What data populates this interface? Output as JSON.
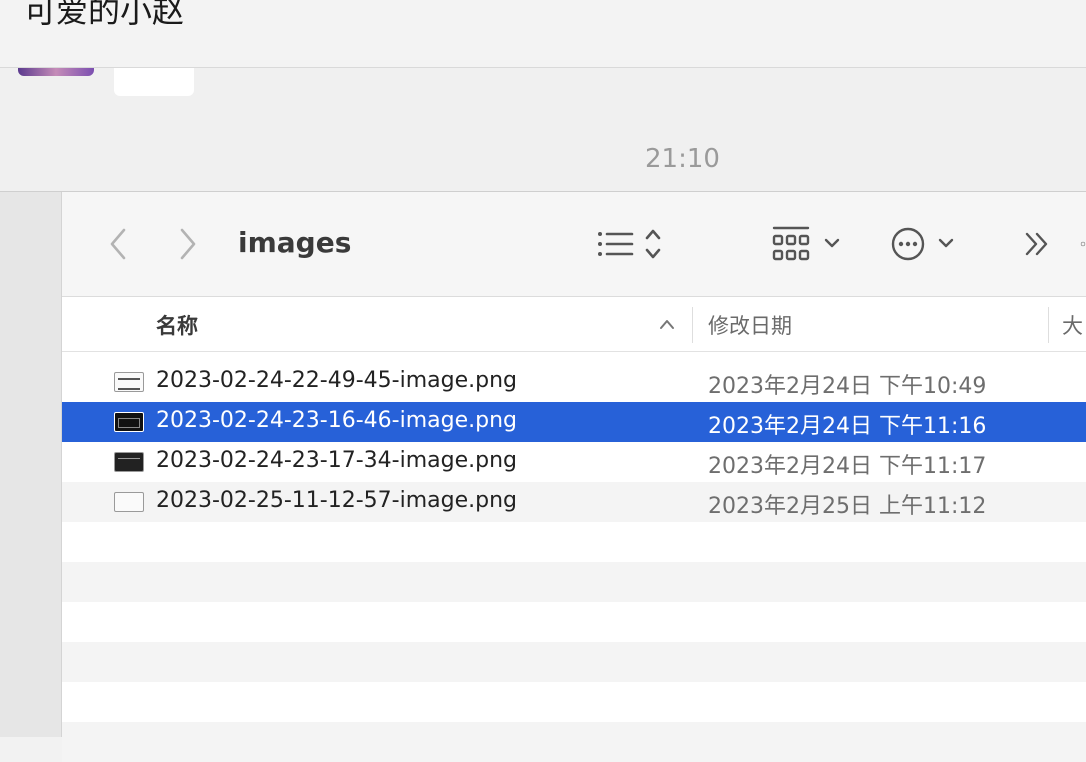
{
  "chat": {
    "title": "可爱的小赵",
    "time": "21:10"
  },
  "finder": {
    "folder_title": "images",
    "toolbar_icons": [
      "back-icon",
      "forward-icon",
      "list-view-icon",
      "group-icon",
      "more-actions-icon",
      "overflow-icon"
    ],
    "columns": {
      "name": "名称",
      "date": "修改日期",
      "size": "大"
    },
    "files": [
      {
        "name": "2023-02-24-22-49-45-image.png",
        "date": "2023年2月24日 下午10:49",
        "selected": false
      },
      {
        "name": "2023-02-24-23-16-46-image.png",
        "date": "2023年2月24日 下午11:16",
        "selected": true
      },
      {
        "name": "2023-02-24-23-17-34-image.png",
        "date": "2023年2月24日 下午11:17",
        "selected": false
      },
      {
        "name": "2023-02-25-11-12-57-image.png",
        "date": "2023年2月25日 上午11:12",
        "selected": false
      }
    ],
    "colors": {
      "selection": "#2761d8",
      "stripe": "#f4f4f4"
    }
  }
}
